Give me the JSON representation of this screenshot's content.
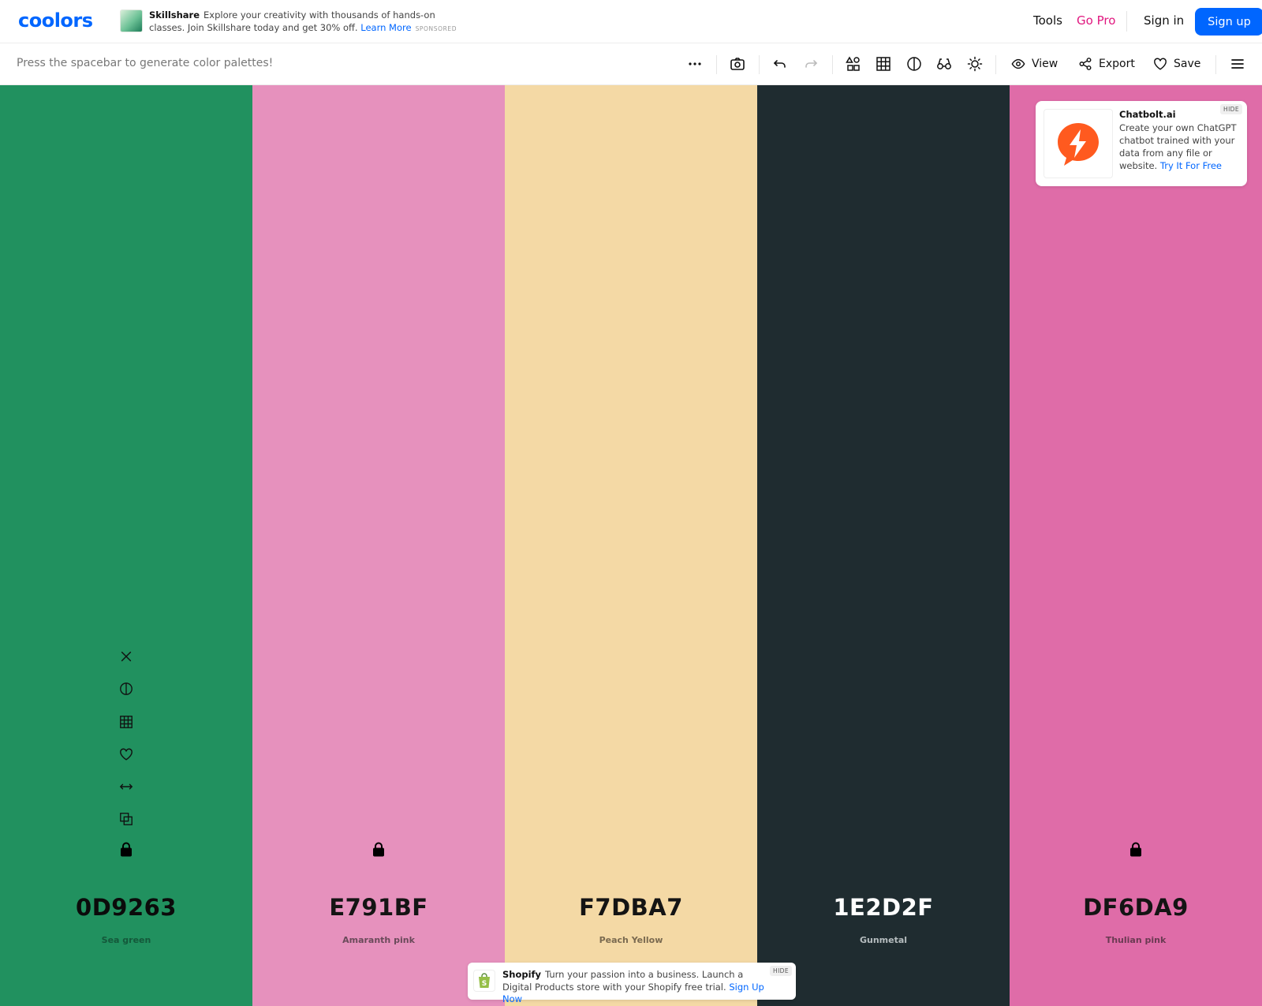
{
  "header": {
    "logo": "coolors",
    "sponsor": {
      "name": "Skillshare",
      "text": "Explore your creativity with thousands of hands-on classes. Join Skillshare today and get 30% off.",
      "link": "Learn More",
      "tag": "SPONSORED"
    },
    "nav": {
      "tools": "Tools",
      "go_pro": "Go Pro",
      "sign_in": "Sign in",
      "sign_up": "Sign up"
    }
  },
  "toolbar": {
    "hint": "Press the spacebar to generate color palettes!",
    "icons": [
      "more-options-icon",
      "camera-icon",
      "undo-icon",
      "redo-icon",
      "shapes-icon",
      "grid-icon",
      "contrast-icon",
      "glasses-icon",
      "sun-icon",
      "menu-icon"
    ],
    "view_label": "View",
    "export_label": "Export",
    "save_label": "Save"
  },
  "palette": {
    "colors": [
      {
        "hex": "0D9263",
        "name": "Sea green",
        "bg": "#21915f",
        "text_color": "#0b0b0b",
        "name_color": "#14583a",
        "show_tools": true,
        "show_lock": true
      },
      {
        "hex": "E791BF",
        "name": "Amaranth pink",
        "bg": "#e691bd",
        "text_color": "#141414",
        "name_color": "#6a4a5a",
        "show_tools": false,
        "show_lock": true
      },
      {
        "hex": "F7DBA7",
        "name": "Peach Yellow",
        "bg": "#f4d9a5",
        "text_color": "#141414",
        "name_color": "#7a6a50",
        "show_tools": false,
        "show_lock": false
      },
      {
        "hex": "1E2D2F",
        "name": "Gunmetal",
        "bg": "#1f2c30",
        "text_color": "#ffffff",
        "name_color": "#b6bdbf",
        "show_tools": false,
        "show_lock": false
      },
      {
        "hex": "DF6DA9",
        "name": "Thulian pink",
        "bg": "#df6ca8",
        "text_color": "#141414",
        "name_color": "#6a3a52",
        "show_tools": false,
        "show_lock": true
      }
    ],
    "column_tools": [
      "close-icon",
      "contrast-icon",
      "shades-grid-icon",
      "heart-icon",
      "drag-arrows-icon",
      "copy-icon"
    ]
  },
  "ad_chatbolt": {
    "title": "Chatbolt.ai",
    "body": "Create your own ChatGPT chatbot trained with your data from any file or website.",
    "link": "Try It For Free",
    "hide": "HIDE"
  },
  "ad_shopify": {
    "title": "Shopify",
    "body": "Turn your passion into a business. Launch a Digital Products store with your Shopify free trial.",
    "link": "Sign Up Now",
    "hide": "HIDE"
  },
  "colors": {
    "accent": "#0066ff",
    "pro": "#e0177f"
  }
}
